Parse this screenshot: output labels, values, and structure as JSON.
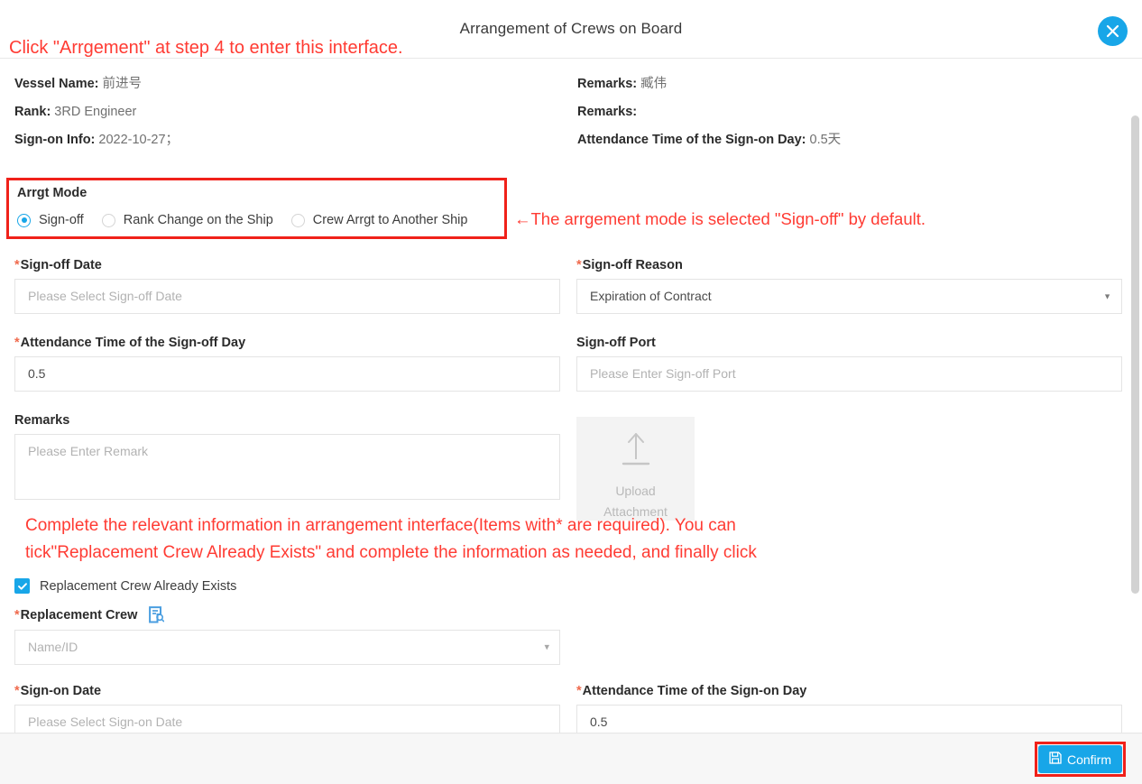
{
  "titlebar": {
    "title": "Arrangement of Crews on Board",
    "close_icon": "close-icon"
  },
  "annotations": {
    "top": "Click \"Arrgement\" at step 4 to enter this interface.",
    "mode": "←The arrgement  mode is selected \"Sign-off\" by default.",
    "block_line1": "Complete the relevant information in arrangement interface(Items with* are required). You can",
    "block_line2": "tick\"Replacement Crew Already Exists\" and complete the information as needed, and finally click"
  },
  "info": {
    "left": [
      {
        "label": "Vessel Name:",
        "value": "前进号"
      },
      {
        "label": "Rank:",
        "value": "3RD Engineer"
      },
      {
        "label": "Sign-on Info:",
        "value": "2022-10-27；"
      }
    ],
    "right": [
      {
        "label": "Remarks:",
        "value": "臧伟"
      },
      {
        "label": "Remarks:",
        "value": ""
      },
      {
        "label": "Attendance Time of the Sign-on Day:",
        "value": "0.5天"
      }
    ]
  },
  "arrgt_mode": {
    "legend": "Arrgt Mode",
    "options": [
      {
        "label": "Sign-off",
        "selected": true
      },
      {
        "label": "Rank Change on the Ship",
        "selected": false
      },
      {
        "label": "Crew Arrgt to Another Ship",
        "selected": false
      }
    ]
  },
  "form": {
    "signoff_date": {
      "label": "Sign-off Date",
      "required": true,
      "placeholder": "Please Select Sign-off Date",
      "value": ""
    },
    "signoff_reason": {
      "label": "Sign-off Reason",
      "required": true,
      "value": "Expiration of Contract",
      "options": [
        "Expiration of Contract"
      ]
    },
    "attendance_signoff": {
      "label": "Attendance Time of the Sign-off Day",
      "required": true,
      "value": "0.5"
    },
    "signoff_port": {
      "label": "Sign-off Port",
      "required": false,
      "placeholder": "Please Enter Sign-off Port",
      "value": ""
    },
    "remarks": {
      "label": "Remarks",
      "required": false,
      "placeholder": "Please Enter Remark",
      "value": ""
    },
    "upload": {
      "line1": "Upload",
      "line2": "Attachment",
      "icon": "upload-arrow-icon"
    },
    "replacement_checkbox": {
      "label": "Replacement Crew Already Exists",
      "checked": true
    },
    "replacement_crew": {
      "label": "Replacement Crew",
      "required": true,
      "placeholder": "Name/ID",
      "value": "",
      "icon": "doc-search-icon"
    },
    "signon_date": {
      "label": "Sign-on Date",
      "required": true,
      "placeholder": "Please Select Sign-on Date",
      "value": ""
    },
    "attendance_signon": {
      "label": "Attendance Time of the Sign-on Day",
      "required": true,
      "value": "0.5"
    }
  },
  "footer": {
    "confirm_label": "Confirm",
    "confirm_icon": "save-floppy-icon"
  },
  "colors": {
    "accent": "#18a6e8",
    "annotation_red": "#ff3b33",
    "highlight_box_red": "#f0211a",
    "required_star": "#f06a4d"
  }
}
